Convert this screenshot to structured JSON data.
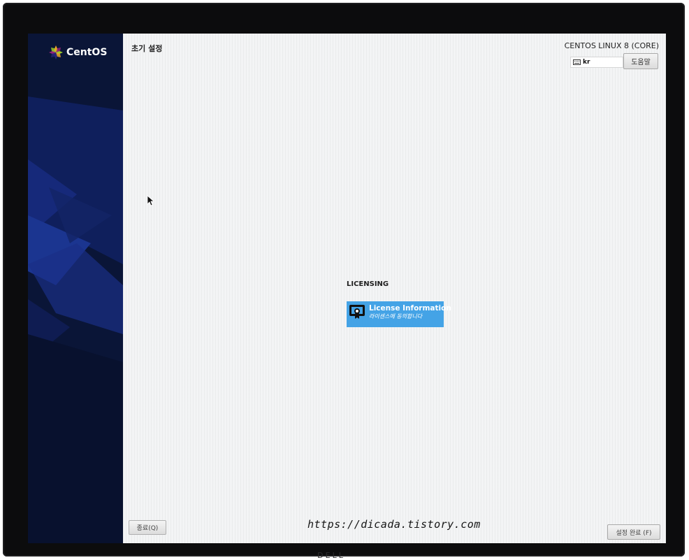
{
  "sidebar": {
    "brand_name": "CentOS",
    "logo_icon": "centos-logo"
  },
  "header": {
    "title": "초기 설정",
    "product": "CENTOS LINUX 8 (CORE)",
    "keyboard_layout": "kr",
    "keyboard_icon": "keyboard-icon",
    "help_label": "도움말"
  },
  "hub": {
    "category": "LICENSING",
    "spokes": [
      {
        "name": "License Information",
        "status": "라이센스에 동의합니다",
        "icon": "license-certificate-icon"
      }
    ]
  },
  "footer": {
    "quit_label": "종료(Q)",
    "finish_label": "설정 완료 (F)"
  },
  "watermark": "https://dicada.tistory.com",
  "colors": {
    "sidebar": "#0a1537",
    "spoke_selected": "#44a3e6",
    "main_bg": "#f3f4f5"
  }
}
